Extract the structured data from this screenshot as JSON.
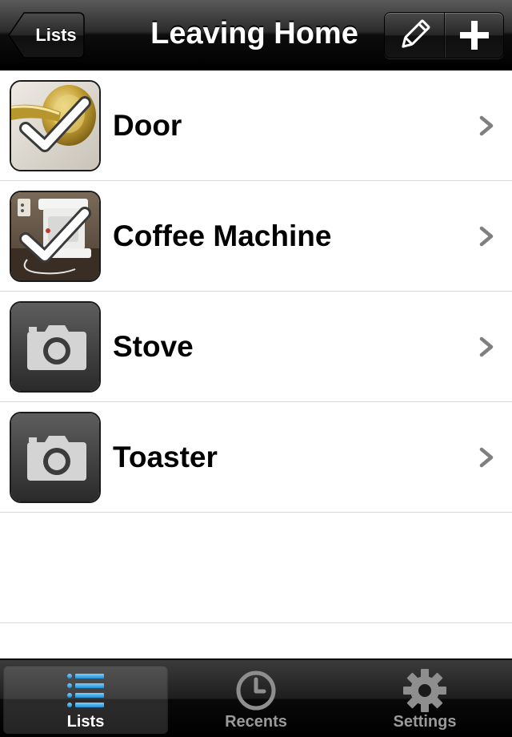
{
  "navbar": {
    "back_label": "Lists",
    "title": "Leaving Home",
    "edit_icon": "pencil-icon",
    "add_icon": "plus-icon"
  },
  "items": [
    {
      "label": "Door",
      "checked": true,
      "thumbnail": "door-handle-photo"
    },
    {
      "label": "Coffee Machine",
      "checked": true,
      "thumbnail": "coffee-machine-photo"
    },
    {
      "label": "Stove",
      "checked": false,
      "thumbnail": "camera-icon"
    },
    {
      "label": "Toaster",
      "checked": false,
      "thumbnail": "camera-icon"
    }
  ],
  "tabbar": {
    "tabs": [
      {
        "label": "Lists",
        "icon": "list-icon",
        "active": true
      },
      {
        "label": "Recents",
        "icon": "clock-icon",
        "active": false
      },
      {
        "label": "Settings",
        "icon": "gear-icon",
        "active": false
      }
    ]
  },
  "colors": {
    "nav_background": "#000000",
    "active_tab_icon": "#4fb3f0",
    "inactive_tab": "#9a9a9a",
    "separator": "#d9d9d9"
  }
}
